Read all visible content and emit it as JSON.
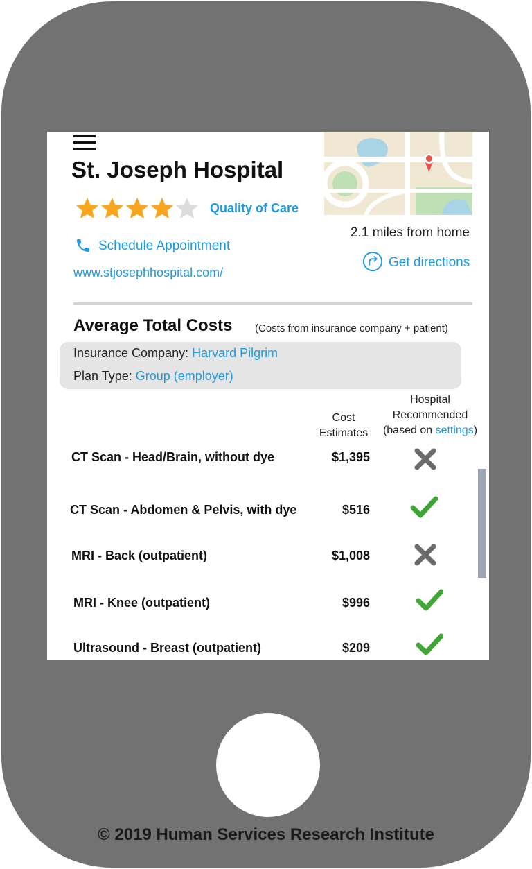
{
  "hospital": {
    "name": "St. Joseph Hospital",
    "rating": 4,
    "rating_max": 5,
    "quality_label": "Quality of Care",
    "distance": "2.1 miles from home",
    "schedule_label": "Schedule Appointment",
    "directions_label": "Get directions",
    "website": "www.stjosephhospital.com/"
  },
  "costs": {
    "title": "Average Total Costs",
    "note": "(Costs from insurance company + patient)",
    "insurance_label": "Insurance Company: ",
    "insurance_value": "Harvard Pilgrim",
    "plan_label": "Plan Type: ",
    "plan_value": "Group (employer)",
    "col_cost": [
      "Cost",
      "Estimates"
    ],
    "col_recommended": [
      "Hospital",
      "Recommended"
    ],
    "col_based_prefix": "(based on ",
    "col_based_link": "settings",
    "col_based_suffix": ")",
    "rows": [
      {
        "procedure": "CT Scan - Head/Brain, without dye",
        "cost": "$1,395",
        "recommended": false
      },
      {
        "procedure": "CT Scan - Abdomen & Pelvis, with dye",
        "cost": "$516",
        "recommended": true
      },
      {
        "procedure": "MRI - Back (outpatient)",
        "cost": "$1,008",
        "recommended": false
      },
      {
        "procedure": "MRI - Knee (outpatient)",
        "cost": "$996",
        "recommended": true
      },
      {
        "procedure": "Ultrasound - Breast (outpatient)",
        "cost": "$209",
        "recommended": true
      }
    ]
  },
  "footer": {
    "copyright": "© 2019 Human Services Research Institute"
  },
  "colors": {
    "accent": "#1f9ae0",
    "star": "#f7a51f",
    "star_empty": "#dcdcdc",
    "check": "#3da634",
    "cross": "#6b6b6b",
    "phone_body": "#727272"
  },
  "icons": [
    "menu-icon",
    "star-icon",
    "phone-icon",
    "directions-icon",
    "map-pin-icon",
    "check-icon",
    "cross-icon"
  ]
}
